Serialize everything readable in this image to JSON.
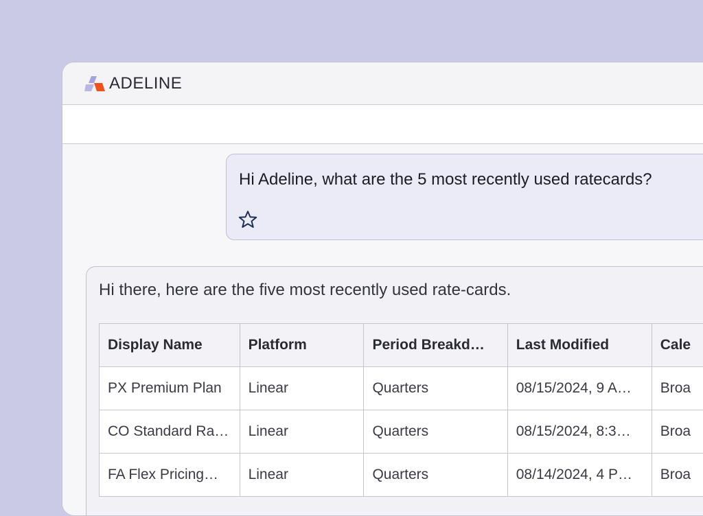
{
  "app": {
    "name": "ADELINE",
    "colors": {
      "background": "#cbcae6",
      "logo_orange": "#f0521e",
      "logo_lilac": "#a6a3dc",
      "user_bubble": "#ebebf7"
    }
  },
  "chat": {
    "user_message": "Hi Adeline, what are the 5 most recently used ratecards?",
    "favorite_icon": "star-outline-icon",
    "assistant_message": "Hi there, here are the five most recently used rate-cards."
  },
  "table": {
    "columns": [
      "Display Name",
      "Platform",
      "Period Breakd…",
      "Last Modified",
      "Cale"
    ],
    "rows": [
      [
        "PX Premium Plan",
        "Linear",
        "Quarters",
        "08/15/2024, 9 A…",
        "Broa"
      ],
      [
        "CO Standard Ra…",
        "Linear",
        "Quarters",
        "08/15/2024, 8:3…",
        "Broa"
      ],
      [
        "FA Flex Pricing…",
        "Linear",
        "Quarters",
        "08/14/2024, 4 P…",
        "Broa"
      ]
    ]
  }
}
